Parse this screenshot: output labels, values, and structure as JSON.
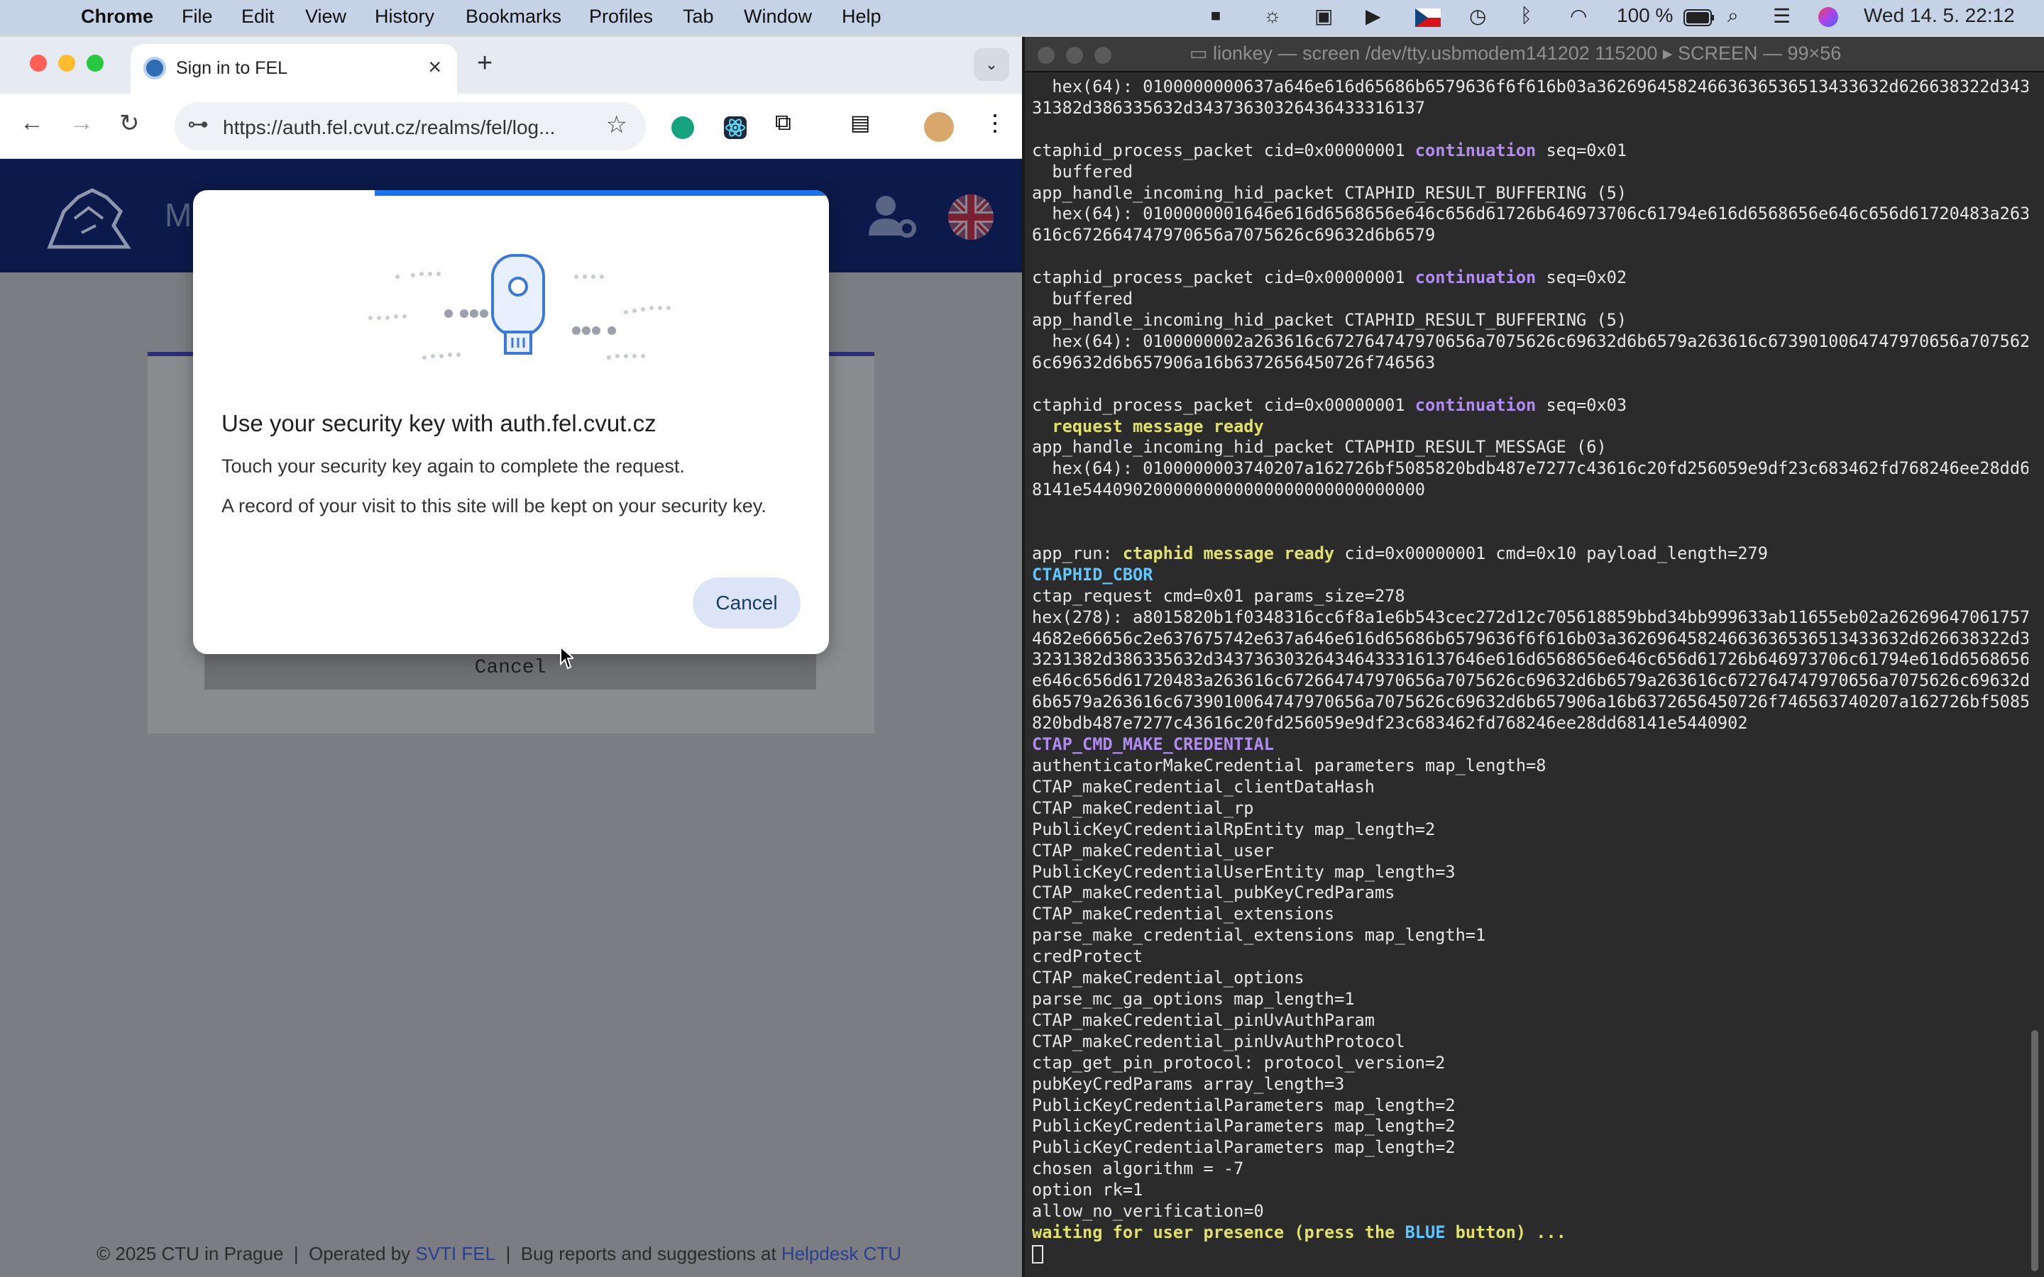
{
  "menubar": {
    "app": "Chrome",
    "menus": [
      "File",
      "Edit",
      "View",
      "History",
      "Bookmarks",
      "Profiles",
      "Tab",
      "Window",
      "Help"
    ],
    "battery": "100 %",
    "clock": "Wed 14. 5.  22:12"
  },
  "chrome": {
    "tab_title": "Sign in to FEL",
    "url": "https://auth.fel.cvut.cz/realms/fel/log..."
  },
  "page": {
    "logo_text": "M",
    "bg_cancel": "Cancel",
    "footer": {
      "copyright": "© 2025 CTU in Prague",
      "sep1": "|",
      "operated": "Operated by",
      "operator_link": "SVTI FEL",
      "sep2": "|",
      "bugs": "Bug reports and suggestions at",
      "helpdesk_link": "Helpdesk CTU"
    }
  },
  "dialog": {
    "title": "Use your security key with auth.fel.cvut.cz",
    "line1": "Touch your security key again to complete the request.",
    "line2": "A record of your visit to this site will be kept on your security key.",
    "cancel": "Cancel"
  },
  "terminal": {
    "title": "lionkey — screen /dev/tty.usbmodem141202 115200 ▸ SCREEN — 99×56",
    "lines": [
      [
        [
          "  hex(64): ",
          ""
        ],
        [
          "0100000000637a646e616d65686b6579636f6f616b03a36269645824663636536513433632d626638322d3432",
          ""
        ]
      ],
      [
        [
          "31382d386335632d34373630326436433316137",
          ""
        ]
      ],
      [
        [
          "",
          ""
        ]
      ],
      [
        [
          "ctaphid_process_packet cid=0x00000001 ",
          ""
        ],
        [
          "continuation",
          "p"
        ],
        [
          " seq=0x01",
          ""
        ]
      ],
      [
        [
          "  buffered",
          ""
        ]
      ],
      [
        [
          "app_handle_incoming_hid_packet CTAPHID_RESULT_BUFFERING (5)",
          ""
        ]
      ],
      [
        [
          "  hex(64): 0100000001646e616d6568656e646c656d61726b646973706c61794e616d6568656e646c656d61720483a263",
          ""
        ]
      ],
      [
        [
          "616c672664747970656a7075626c69632d6b6579",
          ""
        ]
      ],
      [
        [
          "",
          ""
        ]
      ],
      [
        [
          "ctaphid_process_packet cid=0x00000001 ",
          ""
        ],
        [
          "continuation",
          "p"
        ],
        [
          " seq=0x02",
          ""
        ]
      ],
      [
        [
          "  buffered",
          ""
        ]
      ],
      [
        [
          "app_handle_incoming_hid_packet CTAPHID_RESULT_BUFFERING (5)",
          ""
        ]
      ],
      [
        [
          "  hex(64): 0100000002a263616c672764747970656a7075626c69632d6b6579a263616c6739010064747970656a707562",
          ""
        ]
      ],
      [
        [
          "6c69632d6b657906a16b6372656450726f746563",
          ""
        ]
      ],
      [
        [
          "",
          ""
        ]
      ],
      [
        [
          "ctaphid_process_packet cid=0x00000001 ",
          ""
        ],
        [
          "continuation",
          "p"
        ],
        [
          " seq=0x03",
          ""
        ]
      ],
      [
        [
          "  ",
          ""
        ],
        [
          "request message ready",
          "y"
        ]
      ],
      [
        [
          "app_handle_incoming_hid_packet CTAPHID_RESULT_MESSAGE (6)",
          ""
        ]
      ],
      [
        [
          "  hex(64): 0100000003740207a162726bf5085820bdb487e7277c43616c20fd256059e9df23c683462fd768246ee28dd6",
          ""
        ]
      ],
      [
        [
          "8141e5440902000000000000000000000000000",
          ""
        ]
      ],
      [
        [
          "",
          ""
        ]
      ],
      [
        [
          "",
          ""
        ]
      ],
      [
        [
          "app_run: ",
          ""
        ],
        [
          "ctaphid message ready",
          "y"
        ],
        [
          " cid=0x00000001 cmd=0x10 payload_length=279",
          ""
        ]
      ],
      [
        [
          "CTAPHID_CBOR",
          "c"
        ]
      ],
      [
        [
          "ctap_request cmd=0x01 params_size=278",
          ""
        ]
      ],
      [
        [
          "hex(278): a8015820b1f0348316cc6f8a1e6b543cec272d12c705618859bbd34bb999633ab11655eb02a26269647061757",
          ""
        ]
      ],
      [
        [
          "4682e66656c2e637675742e637a646e616d65686b6579636f6f616b03a36269645824663636536513433632d626638322d34",
          ""
        ]
      ],
      [
        [
          "3231382d386335632d343736303264346433316137646e616d6568656e646c656d61726b646973706c61794e616d6568656",
          ""
        ]
      ],
      [
        [
          "e646c656d61720483a263616c672664747970656a7075626c69632d6b6579a263616c672764747970656a7075626c69632d",
          ""
        ]
      ],
      [
        [
          "6b6579a263616c6739010064747970656a7075626c69632d6b657906a16b6372656450726f746563740207a162726bf5085",
          ""
        ]
      ],
      [
        [
          "820bdb487e7277c43616c20fd256059e9df23c683462fd768246ee28dd68141e5440902",
          ""
        ]
      ],
      [
        [
          "CTAP_CMD_MAKE_CREDENTIAL",
          "p"
        ]
      ],
      [
        [
          "authenticatorMakeCredential parameters map_length=8",
          ""
        ]
      ],
      [
        [
          "CTAP_makeCredential_clientDataHash",
          ""
        ]
      ],
      [
        [
          "CTAP_makeCredential_rp",
          ""
        ]
      ],
      [
        [
          "PublicKeyCredentialRpEntity map_length=2",
          ""
        ]
      ],
      [
        [
          "CTAP_makeCredential_user",
          ""
        ]
      ],
      [
        [
          "PublicKeyCredentialUserEntity map_length=3",
          ""
        ]
      ],
      [
        [
          "CTAP_makeCredential_pubKeyCredParams",
          ""
        ]
      ],
      [
        [
          "CTAP_makeCredential_extensions",
          ""
        ]
      ],
      [
        [
          "parse_make_credential_extensions map_length=1",
          ""
        ]
      ],
      [
        [
          "credProtect",
          ""
        ]
      ],
      [
        [
          "CTAP_makeCredential_options",
          ""
        ]
      ],
      [
        [
          "parse_mc_ga_options map_length=1",
          ""
        ]
      ],
      [
        [
          "CTAP_makeCredential_pinUvAuthParam",
          ""
        ]
      ],
      [
        [
          "CTAP_makeCredential_pinUvAuthProtocol",
          ""
        ]
      ],
      [
        [
          "ctap_get_pin_protocol: protocol_version=2",
          ""
        ]
      ],
      [
        [
          "pubKeyCredParams array_length=3",
          ""
        ]
      ],
      [
        [
          "PublicKeyCredentialParameters map_length=2",
          ""
        ]
      ],
      [
        [
          "PublicKeyCredentialParameters map_length=2",
          ""
        ]
      ],
      [
        [
          "PublicKeyCredentialParameters map_length=2",
          ""
        ]
      ],
      [
        [
          "chosen algorithm = -7",
          ""
        ]
      ],
      [
        [
          "option rk=1",
          ""
        ]
      ],
      [
        [
          "allow_no_verification=0",
          ""
        ]
      ],
      [
        [
          "waiting for user presence (press the ",
          "y"
        ],
        [
          "BLUE",
          "c"
        ],
        [
          " button) ...",
          "y"
        ]
      ]
    ]
  }
}
